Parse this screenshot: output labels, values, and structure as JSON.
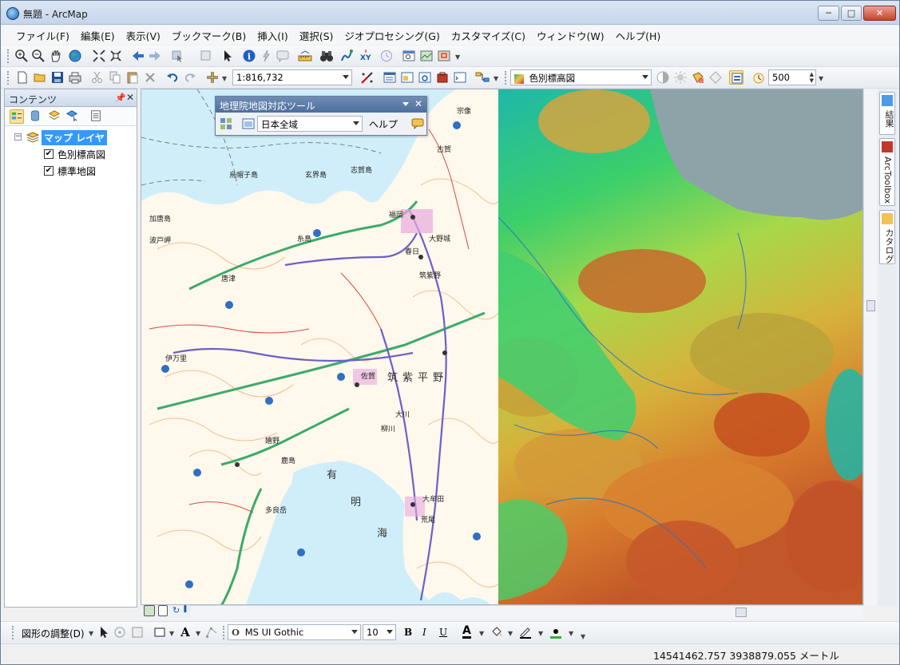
{
  "window": {
    "title": "無題 - ArcMap"
  },
  "menu": [
    "ファイル(F)",
    "編集(E)",
    "表示(V)",
    "ブックマーク(B)",
    "挿入(I)",
    "選択(S)",
    "ジオプロセシング(G)",
    "カスタマイズ(C)",
    "ウィンドウ(W)",
    "ヘルプ(H)"
  ],
  "toolbar": {
    "scale": "1:816,732",
    "layer_select": "色別標高図",
    "spin_value": "500"
  },
  "toc": {
    "title": "コンテンツ",
    "group": "マップ レイヤ",
    "layers": [
      {
        "name": "色別標高図",
        "checked": "✔"
      },
      {
        "name": "標準地図",
        "checked": "✔"
      }
    ]
  },
  "float_tool": {
    "title": "地理院地図対応ツール",
    "region": "日本全域",
    "help": "ヘルプ"
  },
  "dock": {
    "tabs": [
      "結果",
      "ArcToolbox",
      "カタログ"
    ]
  },
  "map_labels": {
    "sea1": "有",
    "sea2": "明",
    "sea3": "海",
    "plain": "筑紫平野",
    "islands": [
      "烏帽子島",
      "玄界島",
      "志賀島",
      "加唐島",
      "波戸岬"
    ],
    "cities": [
      "福岡",
      "古賀",
      "宗像",
      "糸島",
      "春日",
      "筑紫野",
      "大野城",
      "佐賀",
      "唐津",
      "伊万里",
      "大川",
      "柳川",
      "大牟田",
      "荒尾",
      "鹿島",
      "嬉野",
      "多良岳"
    ]
  },
  "drawbar": {
    "label": "図形の調整(D)",
    "font": "MS UI Gothic",
    "size": "10",
    "bold": "B",
    "italic": "I",
    "underline": "U",
    "font_color": "A"
  },
  "status": {
    "coords": "14541462.757  3938879.055 メートル"
  }
}
